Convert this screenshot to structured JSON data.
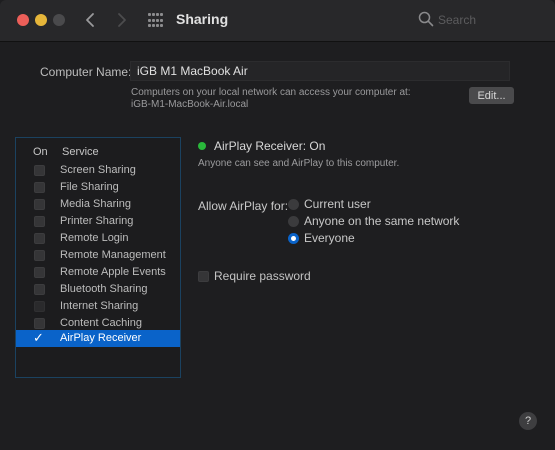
{
  "window": {
    "title": "Sharing",
    "search_placeholder": "Search"
  },
  "computer_name": {
    "label": "Computer Name:",
    "value": "iGB M1 MacBook Air",
    "help_line1": "Computers on your local network can access your computer at:",
    "help_line2": "iGB-M1-MacBook-Air.local",
    "edit_label": "Edit..."
  },
  "services": {
    "header_on": "On",
    "header_service": "Service",
    "items": [
      {
        "label": "Screen Sharing",
        "checked": false
      },
      {
        "label": "File Sharing",
        "checked": false
      },
      {
        "label": "Media Sharing",
        "checked": false
      },
      {
        "label": "Printer Sharing",
        "checked": false
      },
      {
        "label": "Remote Login",
        "checked": false
      },
      {
        "label": "Remote Management",
        "checked": false
      },
      {
        "label": "Remote Apple Events",
        "checked": false
      },
      {
        "label": "Bluetooth Sharing",
        "checked": false
      },
      {
        "label": "Internet Sharing",
        "checked": false
      },
      {
        "label": "Content Caching",
        "checked": false
      },
      {
        "label": "AirPlay Receiver",
        "checked": true,
        "selected": true
      }
    ]
  },
  "airplay": {
    "status_title": "AirPlay Receiver: On",
    "status_desc": "Anyone can see and AirPlay to this computer.",
    "status_color": "#29b73a",
    "allow_label": "Allow AirPlay for:",
    "options": [
      {
        "label": "Current user",
        "selected": false
      },
      {
        "label": "Anyone on the same network",
        "selected": false
      },
      {
        "label": "Everyone",
        "selected": true
      }
    ],
    "require_password_label": "Require password",
    "require_password_checked": false
  },
  "help_label": "?",
  "colors": {
    "accent": "#0a63c9",
    "window_bg": "#1e1e20"
  }
}
